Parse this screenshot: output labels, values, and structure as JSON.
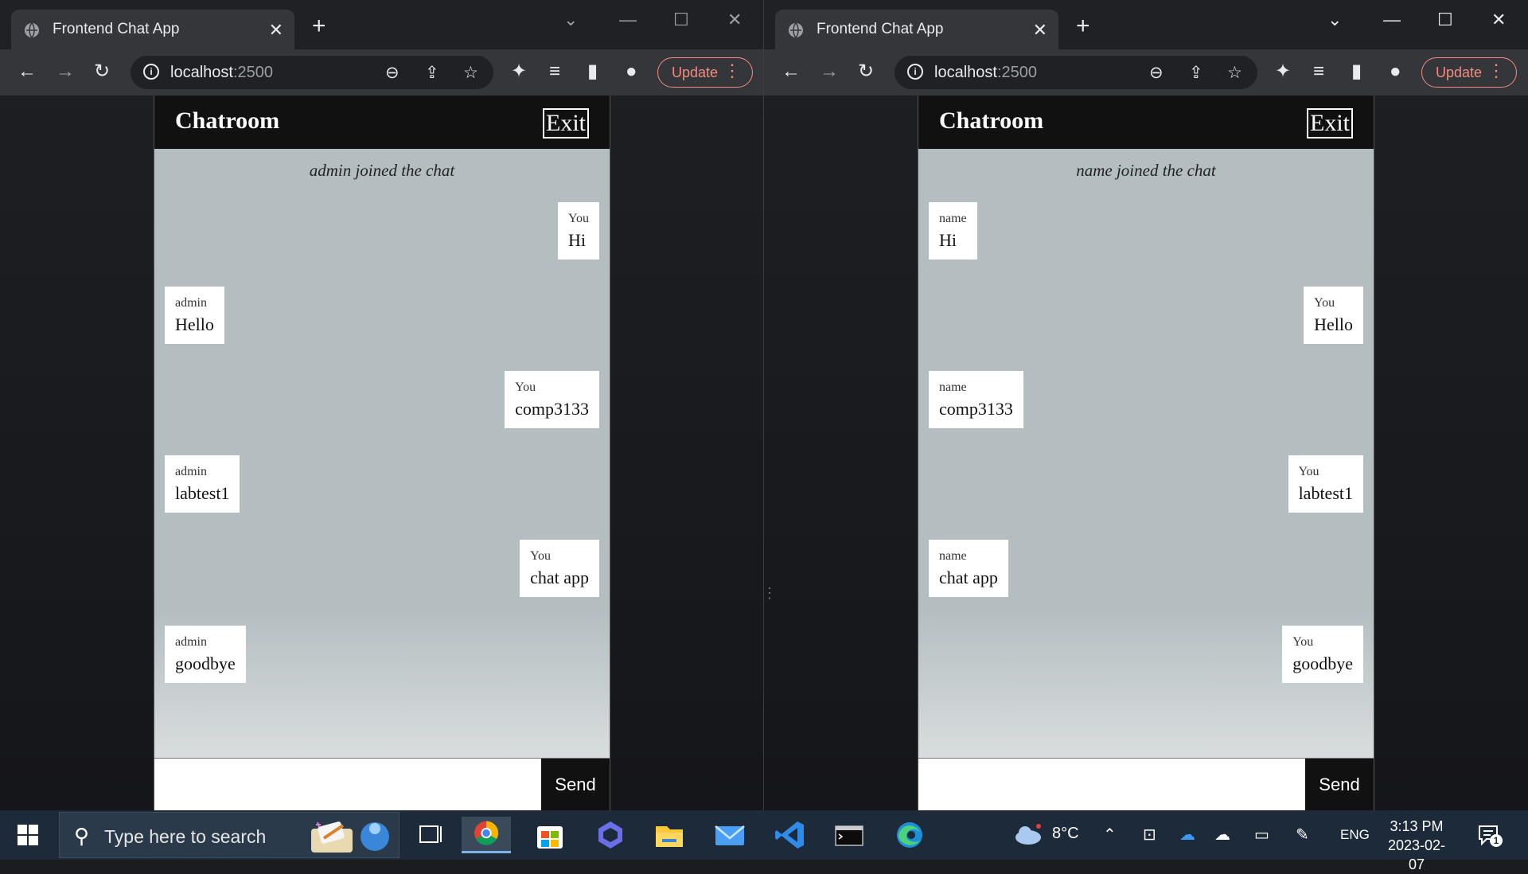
{
  "browser": {
    "tab_title": "Frontend Chat App",
    "address_host": "localhost",
    "address_port": ":2500",
    "update_label": "Update"
  },
  "windows": [
    {
      "chat_title": "Chatroom",
      "exit_label": "Exit",
      "notice": "admin joined the chat",
      "messages": [
        {
          "sender": "You",
          "text": "Hi",
          "side": "right"
        },
        {
          "sender": "admin",
          "text": "Hello",
          "side": "left"
        },
        {
          "sender": "You",
          "text": "comp3133",
          "side": "right"
        },
        {
          "sender": "admin",
          "text": "labtest1",
          "side": "left"
        },
        {
          "sender": "You",
          "text": "chat app",
          "side": "right"
        },
        {
          "sender": "admin",
          "text": "goodbye",
          "side": "left"
        }
      ],
      "send_label": "Send"
    },
    {
      "chat_title": "Chatroom",
      "exit_label": "Exit",
      "notice": "name joined the chat",
      "messages": [
        {
          "sender": "name",
          "text": "Hi",
          "side": "left"
        },
        {
          "sender": "You",
          "text": "Hello",
          "side": "right"
        },
        {
          "sender": "name",
          "text": "comp3133",
          "side": "left"
        },
        {
          "sender": "You",
          "text": "labtest1",
          "side": "right"
        },
        {
          "sender": "name",
          "text": "chat app",
          "side": "left"
        },
        {
          "sender": "You",
          "text": "goodbye",
          "side": "right"
        }
      ],
      "send_label": "Send"
    }
  ],
  "taskbar": {
    "search_placeholder": "Type here to search",
    "weather": "8°C",
    "language": "ENG",
    "time": "3:13 PM",
    "date": "2023-02-07",
    "notification_count": "1"
  },
  "colors": {
    "chat_bg": "#b4bec1",
    "header_bg": "#111111",
    "update_accent": "#f28b82"
  }
}
